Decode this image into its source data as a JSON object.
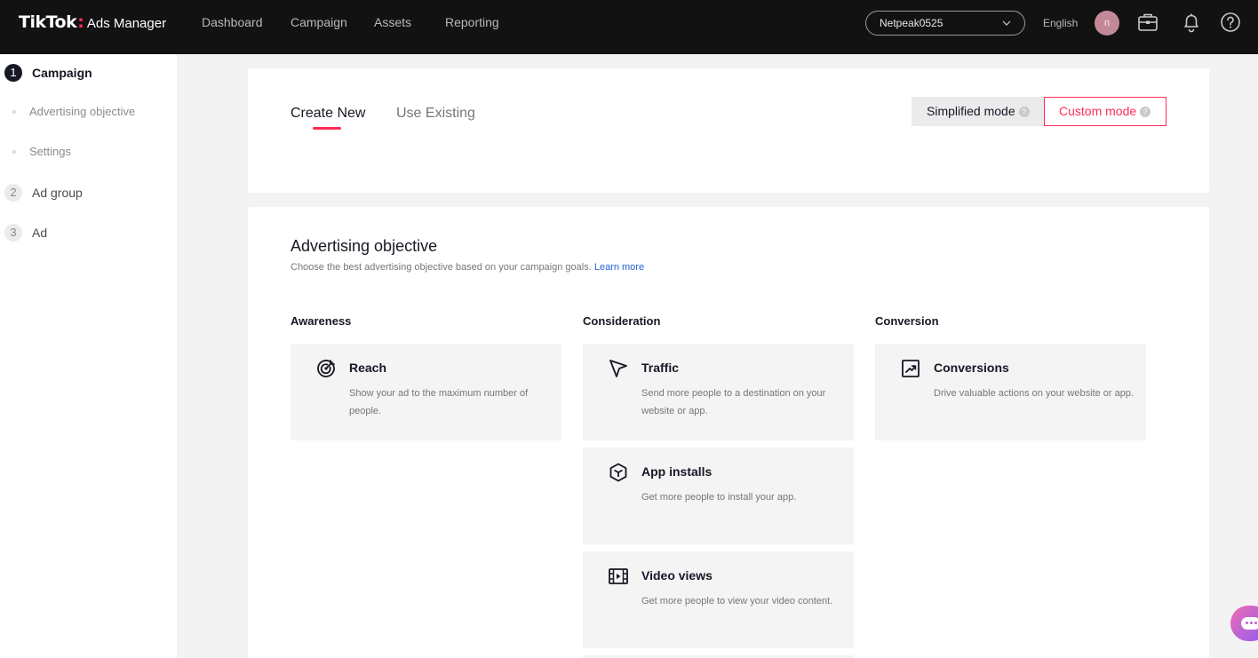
{
  "header": {
    "logo_main": "TikTok",
    "logo_colon": ":",
    "logo_sub": "Ads Manager",
    "nav": [
      "Dashboard",
      "Campaign",
      "Assets",
      "Reporting"
    ],
    "account": "Netpeak0525",
    "language": "English",
    "avatar_initial": "n"
  },
  "sidebar": {
    "steps": [
      {
        "num": "1",
        "label": "Campaign"
      },
      {
        "num": "2",
        "label": "Ad group"
      },
      {
        "num": "3",
        "label": "Ad"
      }
    ],
    "substeps": [
      "Advertising objective",
      "Settings"
    ]
  },
  "campaign_card": {
    "tabs": [
      "Create New",
      "Use Existing"
    ],
    "mode_simple": "Simplified mode",
    "mode_custom": "Custom mode",
    "help_glyph": "?"
  },
  "objective_card": {
    "title": "Advertising objective",
    "subtitle": "Choose the best advertising objective based on your campaign goals.",
    "learn_more": "Learn more",
    "columns": [
      "Awareness",
      "Consideration",
      "Conversion"
    ],
    "objectives": [
      {
        "title": "Reach",
        "desc": "Show your ad to the maximum number of people.",
        "icon": "reach-icon"
      },
      {
        "title": "Traffic",
        "desc": "Send more people to a destination on your website or app.",
        "icon": "cursor-icon"
      },
      {
        "title": "App installs",
        "desc": "Get more people to install your app.",
        "icon": "cube-icon"
      },
      {
        "title": "Video views",
        "desc": "Get more people to view your video content.",
        "icon": "film-icon"
      },
      {
        "title": "Conversions",
        "desc": "Drive valuable actions on your website or app.",
        "icon": "trend-chart-icon"
      }
    ]
  },
  "colors": {
    "accent": "#fe2c55",
    "topbar": "#121212",
    "link": "#2463d6"
  }
}
